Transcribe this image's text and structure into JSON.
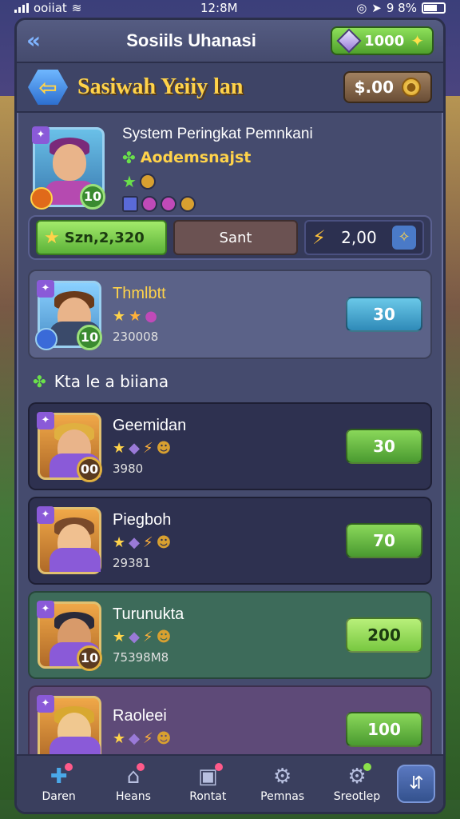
{
  "status_bar": {
    "carrier": "ooiiat",
    "time": "12:8M",
    "battery_text": "9 8%"
  },
  "top_bar": {
    "title": "Sosiils Uhanasi",
    "currency_value": "1000"
  },
  "header": {
    "title": "Sasiwah Yeiiy lan",
    "coins": "$.00"
  },
  "profile": {
    "system_title": "System Peringkat Pemnkani",
    "subtitle": "Aodemsnajst",
    "level": "10"
  },
  "stats": {
    "score": "Szn,2,320",
    "start_label": "Sant",
    "energy": "2,00"
  },
  "featured_player": {
    "name": "Thmlbtt",
    "score": "230008",
    "level": "10",
    "button": "30"
  },
  "section": {
    "title": "Kta le a biiana"
  },
  "players": [
    {
      "name": "Geemidan",
      "score": "3980",
      "level": "00",
      "button": "30",
      "color": "#2e3150",
      "btn": "btn-green"
    },
    {
      "name": "Piegboh",
      "score": "29381",
      "level": "",
      "button": "70",
      "color": "#2e3150",
      "btn": "btn-green"
    },
    {
      "name": "Turunukta",
      "score": "75398M8",
      "level": "10",
      "button": "200",
      "color": "#3d6b5a",
      "btn": "btn-lime"
    },
    {
      "name": "Raoleei",
      "score": "",
      "level": "",
      "button": "100",
      "color": "#5e4a78",
      "btn": "btn-green"
    }
  ],
  "bottom_nav": [
    {
      "label": "Daren",
      "icon": "puzzle-icon"
    },
    {
      "label": "Heans",
      "icon": "home-icon"
    },
    {
      "label": "Rontat",
      "icon": "camera-icon"
    },
    {
      "label": "Pemnas",
      "icon": "gear-icon"
    },
    {
      "label": "Sreotlep",
      "icon": "settings-icon"
    }
  ]
}
